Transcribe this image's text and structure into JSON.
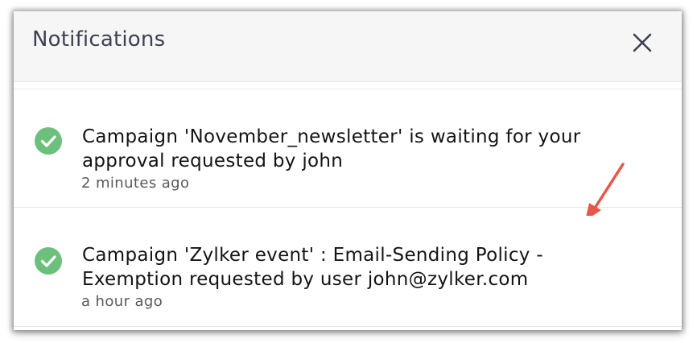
{
  "panel": {
    "title": "Notifications",
    "close_icon": "close-icon"
  },
  "notifications": [
    {
      "message": "Campaign 'November_newsletter' is waiting for your approval requested by john",
      "time": "2 minutes ago",
      "status_icon": "check-circle-icon",
      "status_color": "#6cc07c"
    },
    {
      "message": "Campaign 'Zylker event' : Email-Sending Policy - Exemption requested by user john@zylker.com",
      "time": "a hour ago",
      "status_icon": "check-circle-icon",
      "status_color": "#6cc07c"
    }
  ],
  "annotation": {
    "arrow_icon": "arrow-icon",
    "arrow_color": "#e8574a"
  }
}
